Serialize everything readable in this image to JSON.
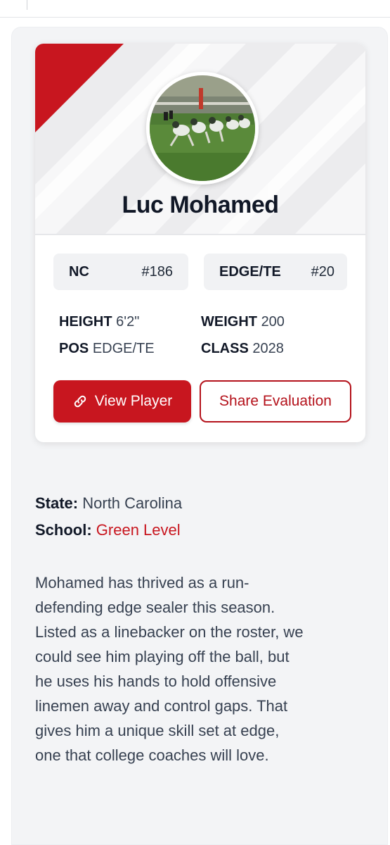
{
  "player": {
    "name": "Luc Mohamed",
    "state_chip": {
      "label": "NC",
      "value": "#186"
    },
    "position_chip": {
      "label": "EDGE/TE",
      "value": "#20"
    },
    "stats": {
      "height_label": "HEIGHT",
      "height_value": "6'2\"",
      "weight_label": "WEIGHT",
      "weight_value": "200",
      "pos_label": "POS",
      "pos_value": "EDGE/TE",
      "class_label": "CLASS",
      "class_value": "2028"
    },
    "buttons": {
      "view_label": "View Player",
      "share_label": "Share Evaluation"
    }
  },
  "details": {
    "state_label": "State:",
    "state_value": "North Carolina",
    "school_label": "School:",
    "school_value": "Green Level"
  },
  "bio_lines": [
    "Mohamed has thrived as a run-",
    "defending edge sealer this season.",
    "Listed as a linebacker on the roster, we",
    "could see him playing off the ball, but",
    "he uses his hands to hold offensive",
    "linemen away and control gaps. That",
    "gives him a unique skill set at edge,",
    "one that college coaches will love."
  ],
  "colors": {
    "accent": "#c8161f",
    "panel_bg": "#f3f4f6",
    "text_dark": "#111827"
  },
  "icons": {
    "view_button_icon": "link-icon"
  }
}
